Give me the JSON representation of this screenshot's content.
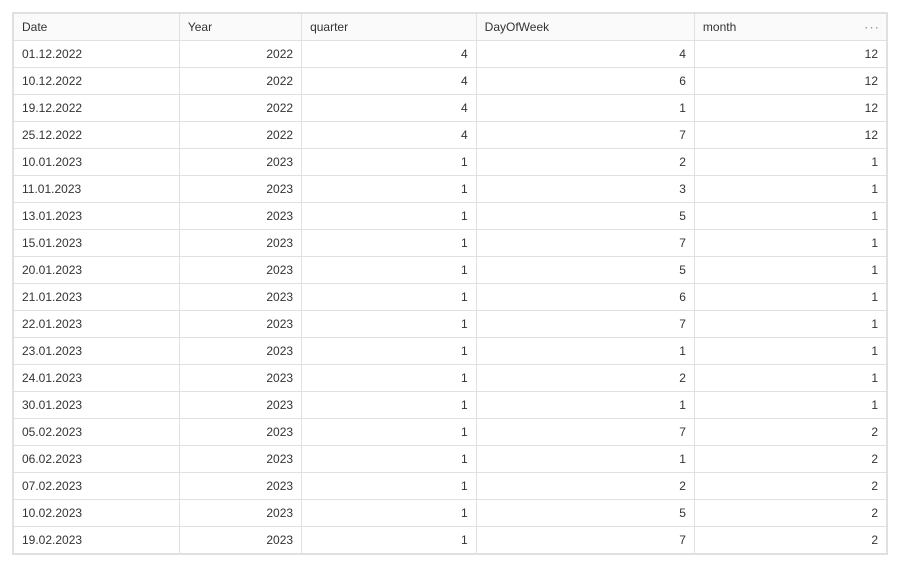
{
  "chart_data": {
    "type": "table",
    "columns": [
      "Date",
      "Year",
      "quarter",
      "DayOfWeek",
      "month"
    ],
    "rows": [
      [
        "01.12.2022",
        2022,
        4,
        4,
        12
      ],
      [
        "10.12.2022",
        2022,
        4,
        6,
        12
      ],
      [
        "19.12.2022",
        2022,
        4,
        1,
        12
      ],
      [
        "25.12.2022",
        2022,
        4,
        7,
        12
      ],
      [
        "10.01.2023",
        2023,
        1,
        2,
        1
      ],
      [
        "11.01.2023",
        2023,
        1,
        3,
        1
      ],
      [
        "13.01.2023",
        2023,
        1,
        5,
        1
      ],
      [
        "15.01.2023",
        2023,
        1,
        7,
        1
      ],
      [
        "20.01.2023",
        2023,
        1,
        5,
        1
      ],
      [
        "21.01.2023",
        2023,
        1,
        6,
        1
      ],
      [
        "22.01.2023",
        2023,
        1,
        7,
        1
      ],
      [
        "23.01.2023",
        2023,
        1,
        1,
        1
      ],
      [
        "24.01.2023",
        2023,
        1,
        2,
        1
      ],
      [
        "30.01.2023",
        2023,
        1,
        1,
        1
      ],
      [
        "05.02.2023",
        2023,
        1,
        7,
        2
      ],
      [
        "06.02.2023",
        2023,
        1,
        1,
        2
      ],
      [
        "07.02.2023",
        2023,
        1,
        2,
        2
      ],
      [
        "10.02.2023",
        2023,
        1,
        5,
        2
      ],
      [
        "19.02.2023",
        2023,
        1,
        7,
        2
      ]
    ]
  },
  "headers": {
    "date": "Date",
    "year": "Year",
    "quarter": "quarter",
    "dayofweek": "DayOfWeek",
    "month": "month"
  },
  "icons": {
    "more": "···"
  }
}
